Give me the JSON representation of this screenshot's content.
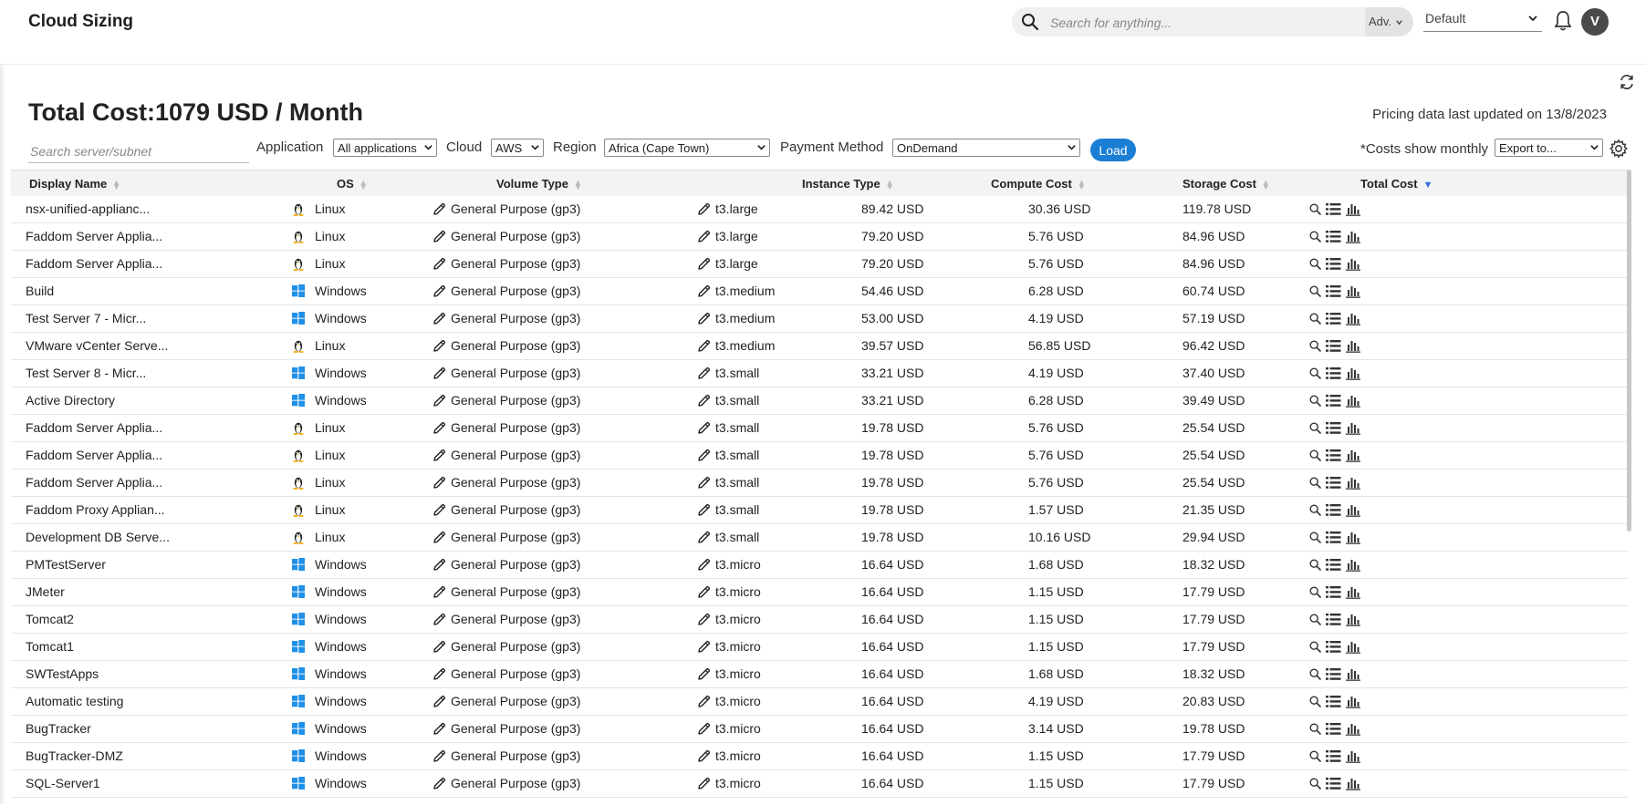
{
  "app": {
    "title": "Cloud Sizing"
  },
  "header": {
    "search_placeholder": "Search for anything...",
    "adv_label": "Adv.",
    "view_select": "Default",
    "avatar_initial": "V"
  },
  "page": {
    "title": "Total Cost:1079 USD / Month",
    "pricing_note": "Pricing data last updated on 13/8/2023"
  },
  "filters": {
    "search_placeholder": "Search server/subnet",
    "application_label": "Application",
    "application_value": "All applications",
    "cloud_label": "Cloud",
    "cloud_value": "AWS",
    "region_label": "Region",
    "region_value": "Africa (Cape Town)",
    "payment_label": "Payment Method",
    "payment_value": "OnDemand",
    "load_label": "Load",
    "costs_note": "*Costs show monthly",
    "export_value": "Export to..."
  },
  "table": {
    "columns": [
      "Display Name",
      "OS",
      "Volume Type",
      "Instance Type",
      "Compute Cost",
      "Storage Cost",
      "Total Cost"
    ],
    "rows": [
      {
        "name": "nsx-unified-applianc...",
        "os": "Linux",
        "volume": "General Purpose (gp3)",
        "instance": "t3.large",
        "compute": "89.42 USD",
        "storage": "30.36 USD",
        "total": "119.78 USD"
      },
      {
        "name": "Faddom Server Applia...",
        "os": "Linux",
        "volume": "General Purpose (gp3)",
        "instance": "t3.large",
        "compute": "79.20 USD",
        "storage": "5.76 USD",
        "total": "84.96 USD"
      },
      {
        "name": "Faddom Server Applia...",
        "os": "Linux",
        "volume": "General Purpose (gp3)",
        "instance": "t3.large",
        "compute": "79.20 USD",
        "storage": "5.76 USD",
        "total": "84.96 USD"
      },
      {
        "name": "Build",
        "os": "Windows",
        "volume": "General Purpose (gp3)",
        "instance": "t3.medium",
        "compute": "54.46 USD",
        "storage": "6.28 USD",
        "total": "60.74 USD"
      },
      {
        "name": "Test Server 7 - Micr...",
        "os": "Windows",
        "volume": "General Purpose (gp3)",
        "instance": "t3.medium",
        "compute": "53.00 USD",
        "storage": "4.19 USD",
        "total": "57.19 USD"
      },
      {
        "name": "VMware vCenter Serve...",
        "os": "Linux",
        "volume": "General Purpose (gp3)",
        "instance": "t3.medium",
        "compute": "39.57 USD",
        "storage": "56.85 USD",
        "total": "96.42 USD"
      },
      {
        "name": "Test Server 8 - Micr...",
        "os": "Windows",
        "volume": "General Purpose (gp3)",
        "instance": "t3.small",
        "compute": "33.21 USD",
        "storage": "4.19 USD",
        "total": "37.40 USD"
      },
      {
        "name": "Active Directory",
        "os": "Windows",
        "volume": "General Purpose (gp3)",
        "instance": "t3.small",
        "compute": "33.21 USD",
        "storage": "6.28 USD",
        "total": "39.49 USD"
      },
      {
        "name": "Faddom Server Applia...",
        "os": "Linux",
        "volume": "General Purpose (gp3)",
        "instance": "t3.small",
        "compute": "19.78 USD",
        "storage": "5.76 USD",
        "total": "25.54 USD"
      },
      {
        "name": "Faddom Server Applia...",
        "os": "Linux",
        "volume": "General Purpose (gp3)",
        "instance": "t3.small",
        "compute": "19.78 USD",
        "storage": "5.76 USD",
        "total": "25.54 USD"
      },
      {
        "name": "Faddom Server Applia...",
        "os": "Linux",
        "volume": "General Purpose (gp3)",
        "instance": "t3.small",
        "compute": "19.78 USD",
        "storage": "5.76 USD",
        "total": "25.54 USD"
      },
      {
        "name": "Faddom Proxy Applian...",
        "os": "Linux",
        "volume": "General Purpose (gp3)",
        "instance": "t3.small",
        "compute": "19.78 USD",
        "storage": "1.57 USD",
        "total": "21.35 USD"
      },
      {
        "name": "Development DB Serve...",
        "os": "Linux",
        "volume": "General Purpose (gp3)",
        "instance": "t3.small",
        "compute": "19.78 USD",
        "storage": "10.16 USD",
        "total": "29.94 USD"
      },
      {
        "name": "PMTestServer",
        "os": "Windows",
        "volume": "General Purpose (gp3)",
        "instance": "t3.micro",
        "compute": "16.64 USD",
        "storage": "1.68 USD",
        "total": "18.32 USD"
      },
      {
        "name": "JMeter",
        "os": "Windows",
        "volume": "General Purpose (gp3)",
        "instance": "t3.micro",
        "compute": "16.64 USD",
        "storage": "1.15 USD",
        "total": "17.79 USD"
      },
      {
        "name": "Tomcat2",
        "os": "Windows",
        "volume": "General Purpose (gp3)",
        "instance": "t3.micro",
        "compute": "16.64 USD",
        "storage": "1.15 USD",
        "total": "17.79 USD"
      },
      {
        "name": "Tomcat1",
        "os": "Windows",
        "volume": "General Purpose (gp3)",
        "instance": "t3.micro",
        "compute": "16.64 USD",
        "storage": "1.15 USD",
        "total": "17.79 USD"
      },
      {
        "name": "SWTestApps",
        "os": "Windows",
        "volume": "General Purpose (gp3)",
        "instance": "t3.micro",
        "compute": "16.64 USD",
        "storage": "1.68 USD",
        "total": "18.32 USD"
      },
      {
        "name": "Automatic testing",
        "os": "Windows",
        "volume": "General Purpose (gp3)",
        "instance": "t3.micro",
        "compute": "16.64 USD",
        "storage": "4.19 USD",
        "total": "20.83 USD"
      },
      {
        "name": "BugTracker",
        "os": "Windows",
        "volume": "General Purpose (gp3)",
        "instance": "t3.micro",
        "compute": "16.64 USD",
        "storage": "3.14 USD",
        "total": "19.78 USD"
      },
      {
        "name": "BugTracker-DMZ",
        "os": "Windows",
        "volume": "General Purpose (gp3)",
        "instance": "t3.micro",
        "compute": "16.64 USD",
        "storage": "1.15 USD",
        "total": "17.79 USD"
      },
      {
        "name": "SQL-Server1",
        "os": "Windows",
        "volume": "General Purpose (gp3)",
        "instance": "t3.micro",
        "compute": "16.64 USD",
        "storage": "1.15 USD",
        "total": "17.79 USD"
      }
    ]
  },
  "icons": {
    "linux": "linux-tux-icon",
    "windows": "windows-logo-icon",
    "edit": "pencil-icon",
    "row_actions": [
      "search-icon",
      "list-icon",
      "bar-chart-icon"
    ]
  },
  "colors": {
    "accent": "#1a7fd4",
    "windows": "#1e90e8",
    "sort_active": "#3a6fd8"
  }
}
